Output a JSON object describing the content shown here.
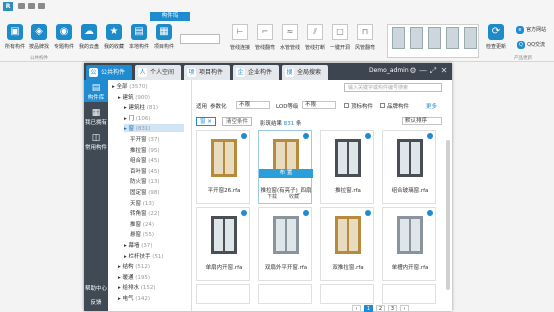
{
  "ribbon": {
    "context_tab": "构件坞",
    "buttons": [
      {
        "label": "所有构件",
        "icon": "all-components-icon"
      },
      {
        "label": "按品牌找",
        "icon": "brand-icon"
      },
      {
        "label": "专题构件",
        "icon": "topic-icon"
      },
      {
        "label": "我的云盘",
        "icon": "cloud-drive-icon"
      },
      {
        "label": "我的收藏",
        "icon": "favorites-icon"
      },
      {
        "label": "本地构件",
        "icon": "local-components-icon"
      },
      {
        "label": "项目构件",
        "icon": "project-components-icon"
      }
    ],
    "group_label": "公共构件",
    "tools": [
      {
        "label": "管线连接"
      },
      {
        "label": "管线翻弯"
      },
      {
        "label": "水管管线"
      },
      {
        "label": "管线打断"
      },
      {
        "label": "一键开洞"
      },
      {
        "label": "风管翻弯"
      }
    ],
    "right": [
      {
        "label": "检查更新",
        "icon": "check-update-icon"
      },
      {
        "label": "官方网站",
        "icon": "website-icon"
      },
      {
        "label": "QQ交流",
        "icon": "qq-icon"
      }
    ],
    "right_group": "产品更新"
  },
  "window": {
    "tabs": [
      {
        "label": "公共构件"
      },
      {
        "label": "个人空间"
      },
      {
        "label": "项目构件"
      },
      {
        "label": "企业构件"
      },
      {
        "label": "全局搜索"
      }
    ],
    "user": "Demo_admin",
    "controls": [
      "⚙",
      "—",
      "⤢",
      "✕"
    ]
  },
  "sidebar": {
    "items": [
      {
        "label": "构件库",
        "icon": "library-icon"
      },
      {
        "label": "我已拥有",
        "icon": "owned-icon"
      },
      {
        "label": "常用构件",
        "icon": "common-icon"
      }
    ],
    "bottom": [
      "帮助中心",
      "反馈"
    ]
  },
  "tree": [
    {
      "text": "全部",
      "count": "(3570)",
      "indent": 0,
      "sel": false
    },
    {
      "text": "建筑",
      "count": "(900)",
      "indent": 1,
      "sel": false
    },
    {
      "text": "建筑柱",
      "count": "(81)",
      "indent": 2,
      "sel": false
    },
    {
      "text": "门",
      "count": "(106)",
      "indent": 2,
      "sel": false
    },
    {
      "text": "窗",
      "count": "(831)",
      "indent": 2,
      "sel": true
    },
    {
      "text": "平开窗",
      "count": "(37)",
      "indent": 3,
      "sel": false
    },
    {
      "text": "推拉窗",
      "count": "(95)",
      "indent": 3,
      "sel": false
    },
    {
      "text": "组合窗",
      "count": "(45)",
      "indent": 3,
      "sel": false
    },
    {
      "text": "百叶窗",
      "count": "(45)",
      "indent": 3,
      "sel": false
    },
    {
      "text": "防火窗",
      "count": "(13)",
      "indent": 3,
      "sel": false
    },
    {
      "text": "固定窗",
      "count": "(98)",
      "indent": 3,
      "sel": false
    },
    {
      "text": "天窗",
      "count": "(13)",
      "indent": 3,
      "sel": false
    },
    {
      "text": "转角窗",
      "count": "(22)",
      "indent": 3,
      "sel": false
    },
    {
      "text": "推窗",
      "count": "(24)",
      "indent": 3,
      "sel": false
    },
    {
      "text": "悬窗",
      "count": "(55)",
      "indent": 3,
      "sel": false
    },
    {
      "text": "幕墙",
      "count": "(37)",
      "indent": 2,
      "sel": false
    },
    {
      "text": "栏杆扶手",
      "count": "(51)",
      "indent": 2,
      "sel": false
    },
    {
      "text": "结构",
      "count": "(512)",
      "indent": 1,
      "sel": false
    },
    {
      "text": "暖通",
      "count": "(195)",
      "indent": 1,
      "sel": false
    },
    {
      "text": "给排水",
      "count": "(152)",
      "indent": 1,
      "sel": false
    },
    {
      "text": "电气",
      "count": "(142)",
      "indent": 1,
      "sel": false
    }
  ],
  "filters": {
    "search_placeholder": "输入关键字或构件编号搜索",
    "use_label": "适用",
    "use_value": "参数化",
    "use_value2": "不限",
    "lod_label": "LOD等级",
    "lod_value": "不限",
    "chk1": "顶标构件",
    "chk2": "品牌构件",
    "more": "更多",
    "chip": "窗",
    "clear": "清空条件",
    "result_prefix": "影筑结果",
    "result_count": "831",
    "result_suffix": "条",
    "sort": "默认排序"
  },
  "cards": [
    {
      "name": "平开窗26.rfa",
      "type": "wood"
    },
    {
      "name": "推拉窗(有亮子)_四扇",
      "type": "wood"
    },
    {
      "name": "推拉窗.rfa",
      "type": "dark"
    },
    {
      "name": "组合玻璃窗.rfa",
      "type": "dark"
    },
    {
      "name": "单扇内开窗.rfa",
      "type": "dark"
    },
    {
      "name": "双扇外平开窗.rfa",
      "type": "grey"
    },
    {
      "name": "双推拉窗.rfa",
      "type": "wood"
    },
    {
      "name": "单槽内开窗.rfa",
      "type": "grey"
    }
  ],
  "hover": {
    "layout": "布 置",
    "download": "下载",
    "fav": "收藏"
  },
  "pagination": [
    "‹",
    "1",
    "2",
    "3",
    "›"
  ]
}
